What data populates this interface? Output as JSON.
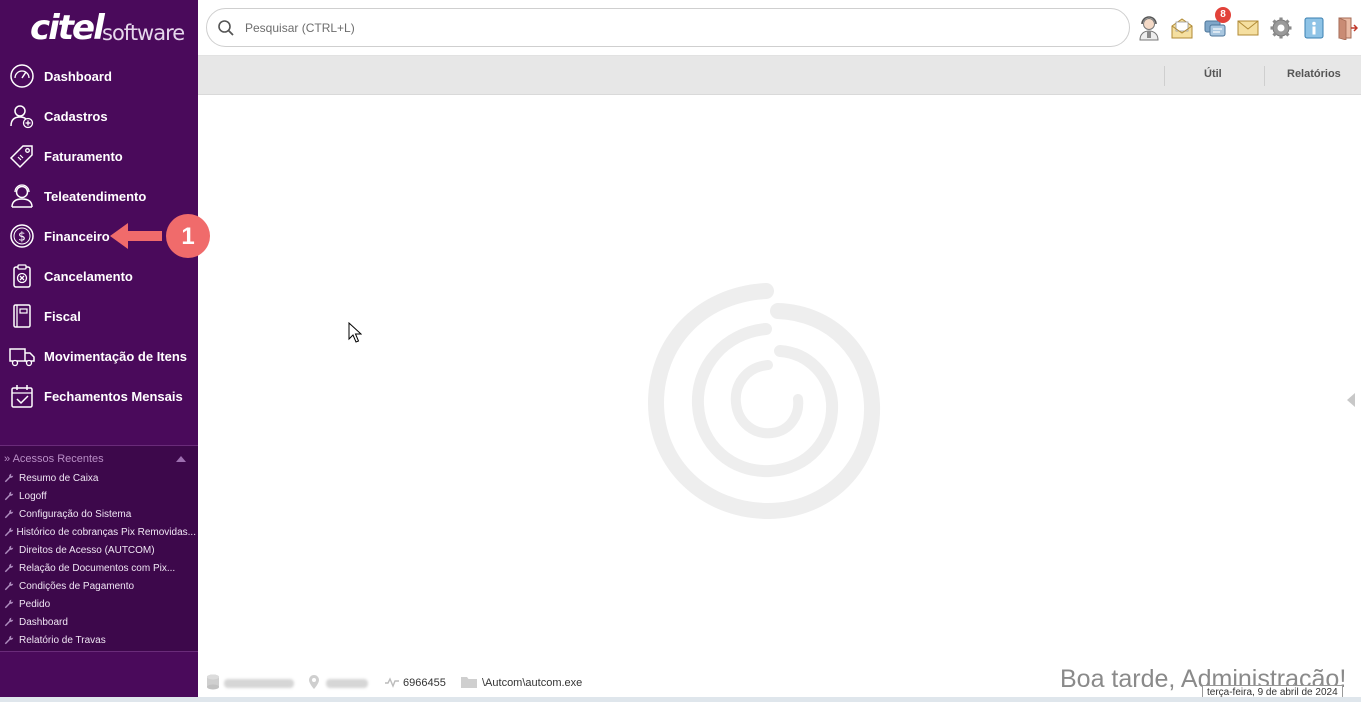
{
  "brand": {
    "name": "citel",
    "suffix": "software"
  },
  "search": {
    "placeholder": "Pesquisar (CTRL+L)"
  },
  "topbar": {
    "icons": [
      "support-agent-icon",
      "mail-open-icon",
      "chat-messages-icon",
      "envelope-icon",
      "gear-icon",
      "info-icon",
      "exit-door-icon"
    ],
    "notification_count": "8"
  },
  "sidebar": {
    "items": [
      {
        "label": "Dashboard",
        "icon": "speedometer-icon"
      },
      {
        "label": "Cadastros",
        "icon": "user-add-icon"
      },
      {
        "label": "Faturamento",
        "icon": "price-tag-icon"
      },
      {
        "label": "Teleatendimento",
        "icon": "headset-icon"
      },
      {
        "label": "Financeiro",
        "icon": "dollar-coin-icon"
      },
      {
        "label": "Cancelamento",
        "icon": "clipboard-cancel-icon"
      },
      {
        "label": "Fiscal",
        "icon": "ledger-book-icon"
      },
      {
        "label": "Movimentação de Itens",
        "icon": "delivery-truck-icon"
      },
      {
        "label": "Fechamentos Mensais",
        "icon": "calendar-check-icon"
      }
    ]
  },
  "recent": {
    "title": "» Acessos Recentes",
    "items": [
      "Resumo de Caixa",
      "Logoff",
      "Configuração do Sistema",
      "Histórico de cobranças Pix Removidas...",
      "Direitos de Acesso (AUTCOM)",
      "Relação de Documentos com Pix...",
      "Condições de Pagamento",
      "Pedido",
      "Dashboard",
      "Relatório de Travas"
    ]
  },
  "subbar": {
    "util": "Útil",
    "relatorios": "Relatórios"
  },
  "annotation": {
    "step": "1",
    "color": "#f06b6b"
  },
  "status": {
    "pid": "6966455",
    "path": "\\Autcom\\autcom.exe",
    "greeting": "Boa tarde, Administração!",
    "date": "terça-feira, 9 de abril de 2024"
  },
  "colors": {
    "sidebar": "#4a0a5b",
    "recent_bg": "#3d084b",
    "badge": "#e2423a"
  }
}
